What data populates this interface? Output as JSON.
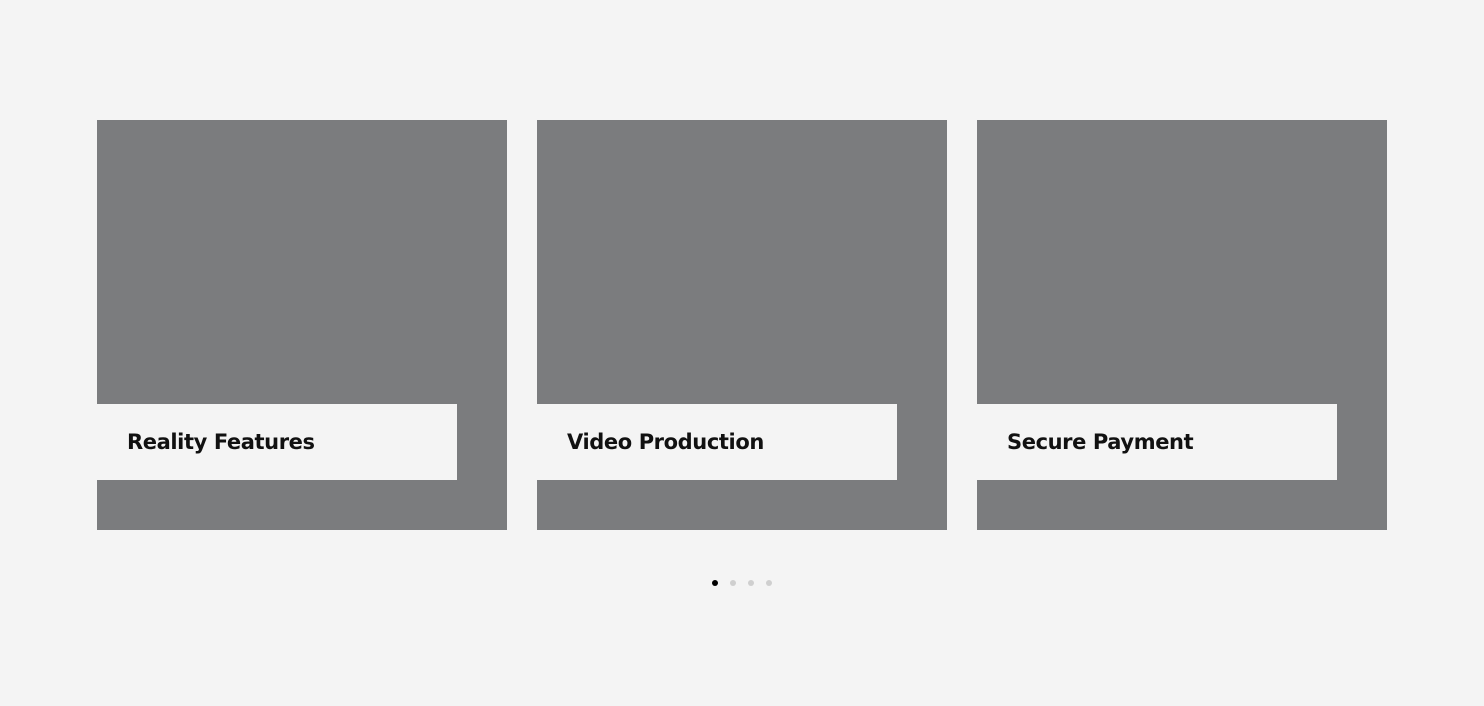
{
  "cards": [
    {
      "title": "Reality Features"
    },
    {
      "title": "Video Production"
    },
    {
      "title": "Secure Payment"
    }
  ],
  "pagination": {
    "total": 4,
    "active_index": 0
  },
  "colors": {
    "background": "#f4f4f4",
    "card_image": "#7b7c7e",
    "dot_active": "#000000",
    "dot_inactive": "#cfcfcf",
    "title_text": "#111111"
  }
}
